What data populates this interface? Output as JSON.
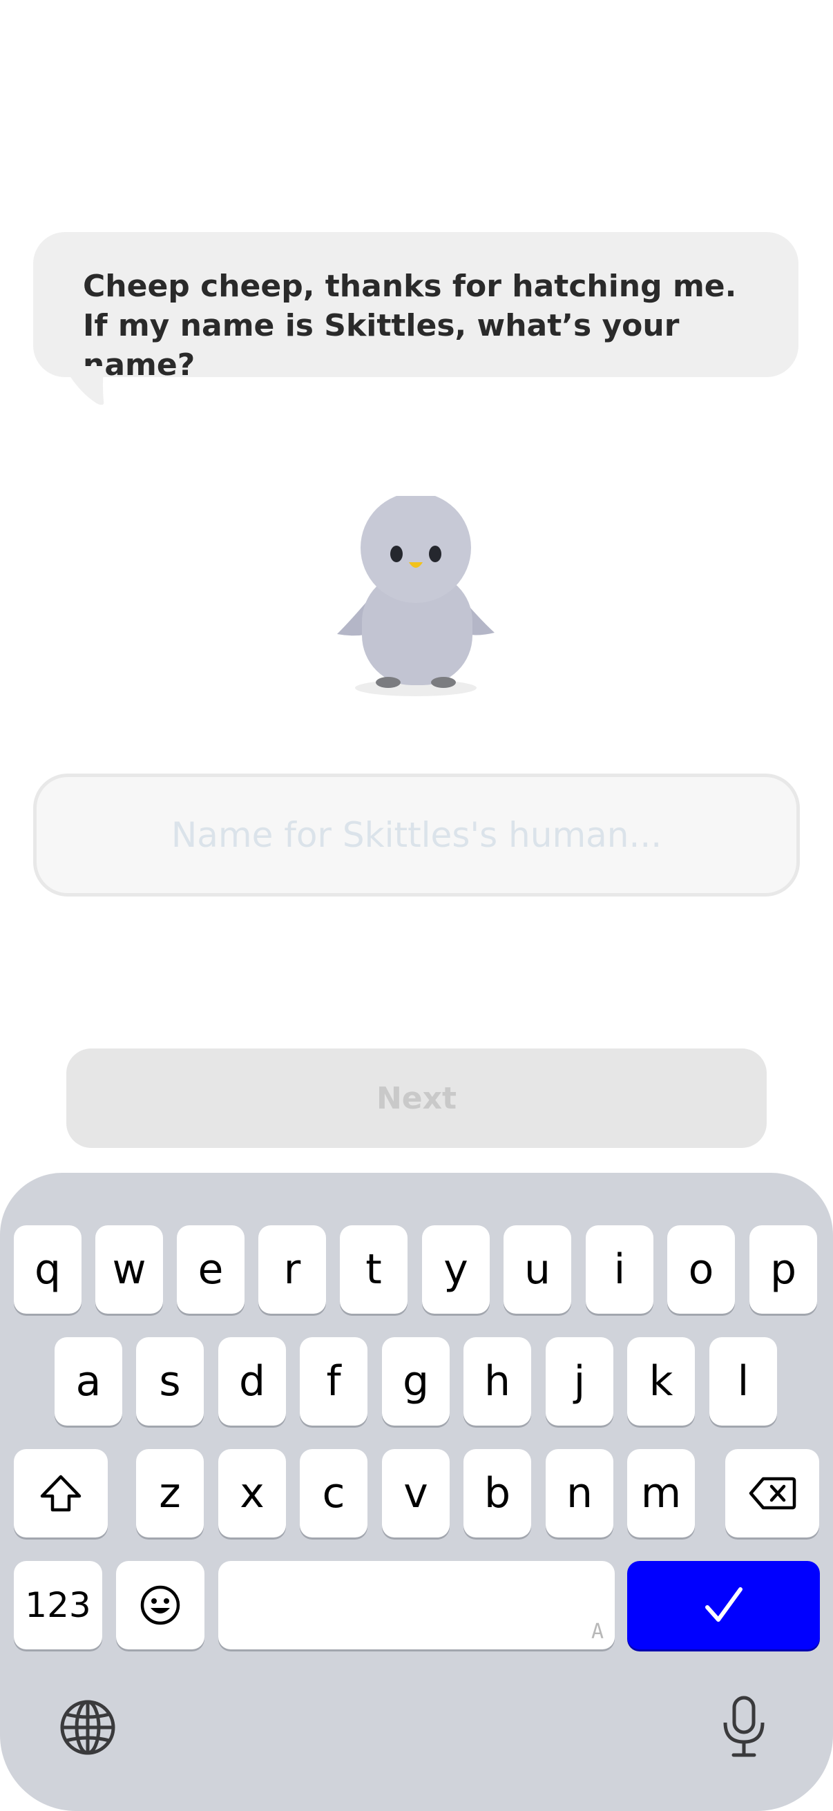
{
  "bubble": {
    "message": "Cheep cheep, thanks for hatching me. If my name is Skittles, what’s your name?"
  },
  "name_field": {
    "placeholder": "Name for Skittles's human...",
    "value": ""
  },
  "next_button": {
    "label": "Next"
  },
  "keyboard": {
    "row1": [
      "q",
      "w",
      "e",
      "r",
      "t",
      "y",
      "u",
      "i",
      "o",
      "p"
    ],
    "row2": [
      "a",
      "s",
      "d",
      "f",
      "g",
      "h",
      "j",
      "k",
      "l"
    ],
    "row3": [
      "z",
      "x",
      "c",
      "v",
      "b",
      "n",
      "m"
    ],
    "numbers_label": "123",
    "space_mark": "A",
    "icons": {
      "shift": "shift-icon",
      "backspace": "backspace-icon",
      "emoji": "emoji-icon",
      "done": "checkmark-icon",
      "globe": "globe-icon",
      "mic": "microphone-icon"
    },
    "done_color": "#0000ff"
  },
  "colors": {
    "bubble": "#efefef",
    "keyboard": "#d0d3da",
    "button_disabled": "#e6e6e6"
  }
}
